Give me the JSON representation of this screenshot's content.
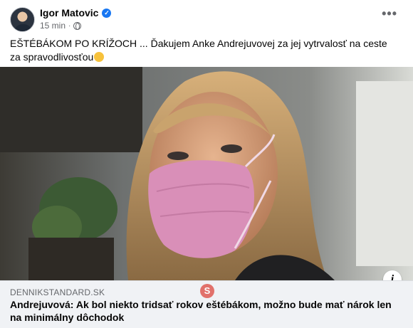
{
  "post": {
    "author": "Igor Matovic",
    "timestamp": "15 min",
    "separator": "·",
    "text": "EŠTÉBÁKOM PO KRÍŽOCH ... Ďakujem Anke Andrejuvovej za jej vytrvalosť na ceste za spravodlivosťou",
    "more_label": "•••"
  },
  "link_preview": {
    "domain": "DENNIKSTANDARD.SK",
    "title": "Andrejuvová: Ak bol niekto tridsať rokov eštébákom, možno bude mať nárok len na minimálny dôchodok",
    "watermark_letter": "S"
  },
  "colors": {
    "accent": "#1877f2",
    "secondary_text": "#65676b",
    "link_bg": "#f0f2f5",
    "mask": "#d98fb8"
  },
  "icons": {
    "verified": "verified-badge-icon",
    "audience": "globe-icon",
    "menu": "more-options-icon",
    "info": "info-icon"
  }
}
